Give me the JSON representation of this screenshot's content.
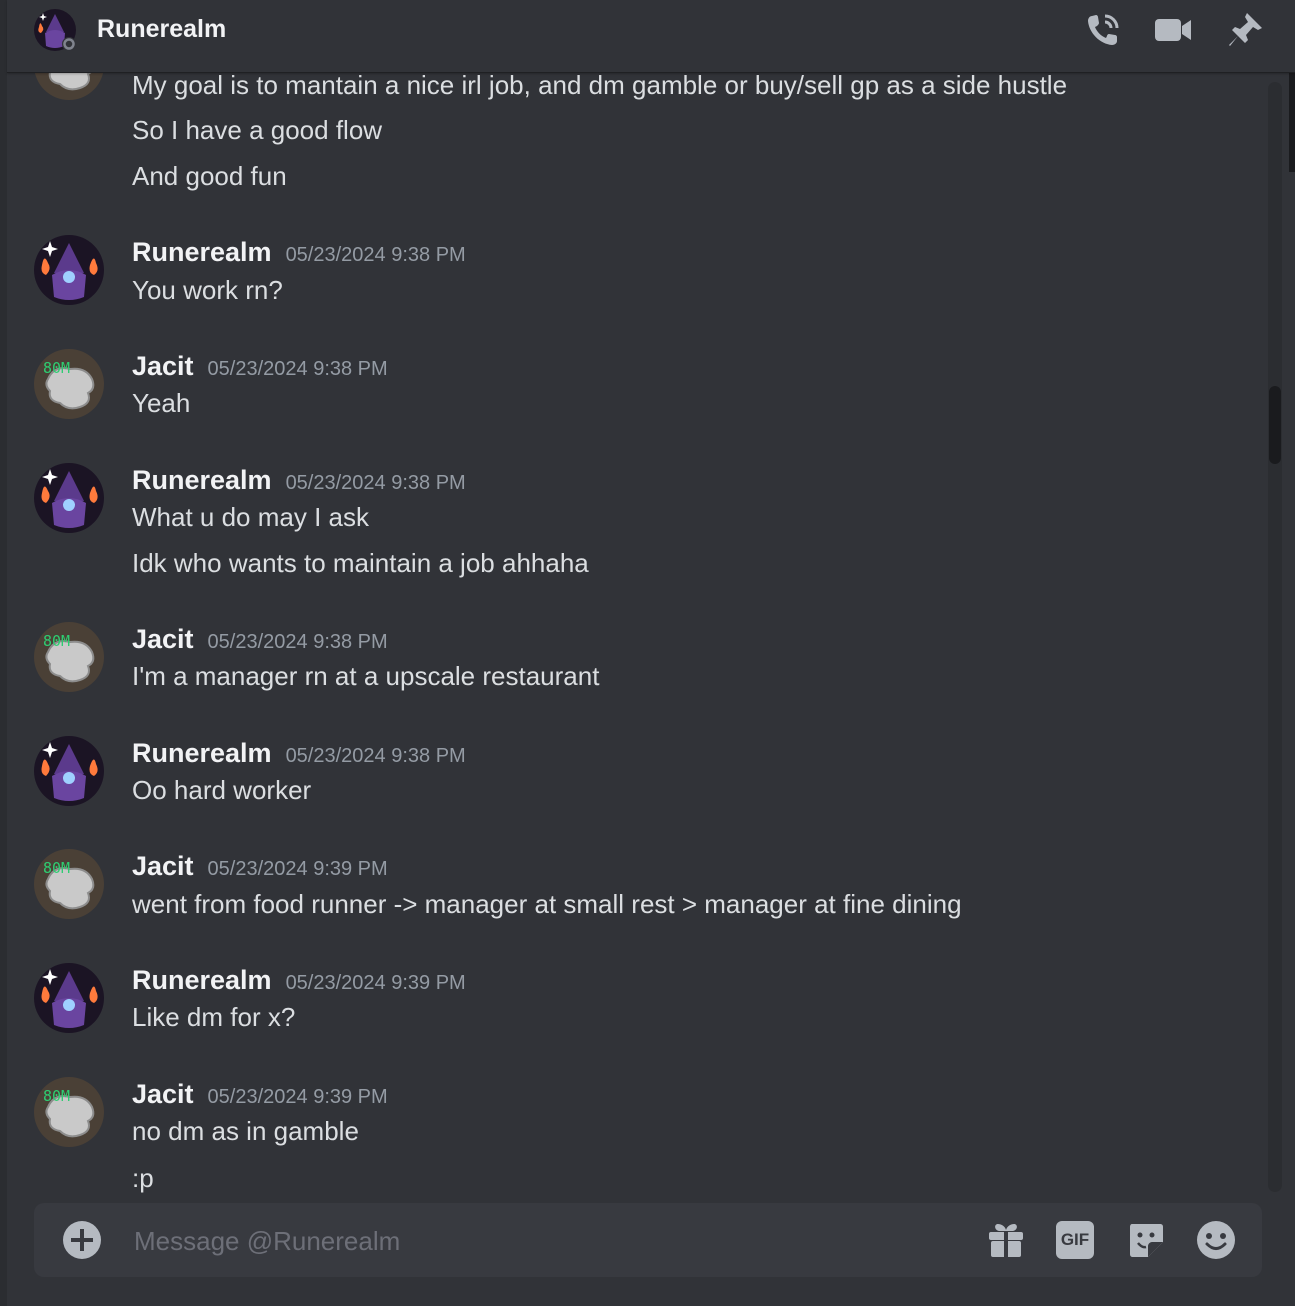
{
  "header": {
    "title": "Runerealm",
    "icons": [
      "phone-call-icon",
      "video-camera-icon",
      "pin-icon"
    ]
  },
  "partial_top": {
    "lines": [
      "My goal is to mantain a nice irl job, and dm gamble or buy/sell gp as a side hustle",
      "So I have a good flow",
      "And good fun"
    ]
  },
  "messages": [
    {
      "user": "Runerealm",
      "time": "05/23/2024 9:38 PM",
      "lines": [
        "You work rn?"
      ]
    },
    {
      "user": "Jacit",
      "time": "05/23/2024 9:38 PM",
      "lines": [
        "Yeah"
      ]
    },
    {
      "user": "Runerealm",
      "time": "05/23/2024 9:38 PM",
      "lines": [
        "What u do may I ask",
        "Idk who wants to maintain a job ahhaha"
      ]
    },
    {
      "user": "Jacit",
      "time": "05/23/2024 9:38 PM",
      "lines": [
        "I'm a manager rn at a upscale restaurant"
      ]
    },
    {
      "user": "Runerealm",
      "time": "05/23/2024 9:38 PM",
      "lines": [
        "Oo hard worker"
      ]
    },
    {
      "user": "Jacit",
      "time": "05/23/2024 9:39 PM",
      "lines": [
        "went from food runner -> manager at small rest > manager at fine dining"
      ]
    },
    {
      "user": "Runerealm",
      "time": "05/23/2024 9:39 PM",
      "lines": [
        "Like dm for x?"
      ]
    },
    {
      "user": "Jacit",
      "time": "05/23/2024 9:39 PM",
      "lines": [
        "no dm as in gamble",
        ":p"
      ]
    }
  ],
  "avatars": {
    "jacit_badge": "80M"
  },
  "composer": {
    "placeholder": "Message @Runerealm",
    "gif_label": "GIF",
    "icons": [
      "add-icon",
      "gift-icon",
      "gif-icon",
      "sticker-icon",
      "emoji-icon"
    ]
  },
  "colors": {
    "background": "#313338",
    "composer": "#383a40",
    "username": "#f2f3f5",
    "timestamp": "#949ba4",
    "icon": "#b5bac1"
  }
}
